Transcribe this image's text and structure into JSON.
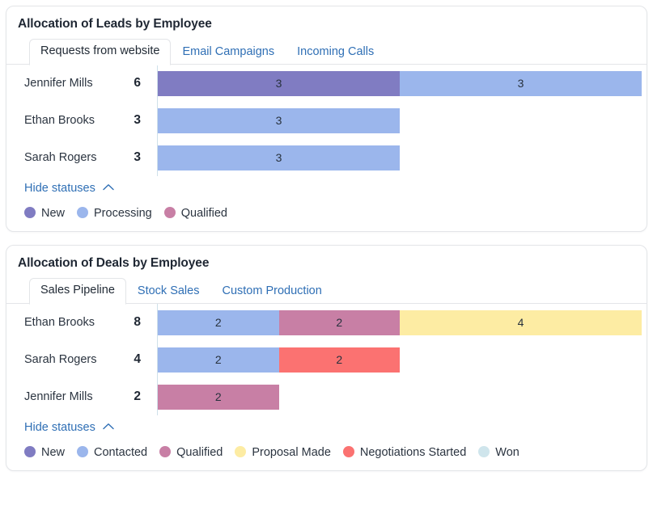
{
  "colors": {
    "new": "#807cc2",
    "processing": "#9bb6ec",
    "contacted": "#9bb6ec",
    "qualified": "#c87fa5",
    "proposal_made": "#fdeca3",
    "negotiations_started": "#fb7271",
    "won": "#cfe5ec",
    "link": "#2f6fb5",
    "axis": "#cfe0ea"
  },
  "cards": [
    {
      "title": "Allocation of Leads by Employee",
      "tabs": [
        {
          "label": "Requests from website",
          "active": true
        },
        {
          "label": "Email Campaigns",
          "active": false
        },
        {
          "label": "Incoming Calls",
          "active": false
        }
      ],
      "legend_toggle": "Hide statuses",
      "chart_data": {
        "type": "bar",
        "orientation": "horizontal",
        "stacked": true,
        "title": "Allocation of Leads by Employee",
        "xlabel": "",
        "ylabel": "",
        "xlim": [
          0,
          6
        ],
        "grid": false,
        "legend_position": "bottom",
        "categories": [
          "Jennifer Mills",
          "Ethan Brooks",
          "Sarah Rogers"
        ],
        "totals": [
          6,
          3,
          3
        ],
        "series": [
          {
            "name": "New",
            "color": "#807cc2",
            "values": [
              3,
              0,
              0
            ]
          },
          {
            "name": "Processing",
            "color": "#9bb6ec",
            "values": [
              3,
              3,
              3
            ]
          },
          {
            "name": "Qualified",
            "color": "#c87fa5",
            "values": [
              0,
              0,
              0
            ]
          }
        ]
      },
      "legend": [
        {
          "label": "New",
          "color": "#807cc2"
        },
        {
          "label": "Processing",
          "color": "#9bb6ec"
        },
        {
          "label": "Qualified",
          "color": "#c87fa5"
        }
      ]
    },
    {
      "title": "Allocation of Deals by Employee",
      "tabs": [
        {
          "label": "Sales Pipeline",
          "active": true
        },
        {
          "label": "Stock Sales",
          "active": false
        },
        {
          "label": "Custom Production",
          "active": false
        }
      ],
      "legend_toggle": "Hide statuses",
      "chart_data": {
        "type": "bar",
        "orientation": "horizontal",
        "stacked": true,
        "title": "Allocation of Deals by Employee",
        "xlabel": "",
        "ylabel": "",
        "xlim": [
          0,
          8
        ],
        "grid": false,
        "legend_position": "bottom",
        "categories": [
          "Ethan Brooks",
          "Sarah Rogers",
          "Jennifer Mills"
        ],
        "totals": [
          8,
          4,
          2
        ],
        "series": [
          {
            "name": "New",
            "color": "#807cc2",
            "values": [
              0,
              0,
              0
            ]
          },
          {
            "name": "Contacted",
            "color": "#9bb6ec",
            "values": [
              2,
              2,
              0
            ]
          },
          {
            "name": "Qualified",
            "color": "#c87fa5",
            "values": [
              2,
              0,
              2
            ]
          },
          {
            "name": "Proposal Made",
            "color": "#fdeca3",
            "values": [
              4,
              0,
              0
            ]
          },
          {
            "name": "Negotiations Started",
            "color": "#fb7271",
            "values": [
              0,
              2,
              0
            ]
          },
          {
            "name": "Won",
            "color": "#cfe5ec",
            "values": [
              0,
              0,
              0
            ]
          }
        ]
      },
      "legend": [
        {
          "label": "New",
          "color": "#807cc2"
        },
        {
          "label": "Contacted",
          "color": "#9bb6ec"
        },
        {
          "label": "Qualified",
          "color": "#c87fa5"
        },
        {
          "label": "Proposal Made",
          "color": "#fdeca3"
        },
        {
          "label": "Negotiations Started",
          "color": "#fb7271"
        },
        {
          "label": "Won",
          "color": "#cfe5ec"
        }
      ]
    }
  ]
}
